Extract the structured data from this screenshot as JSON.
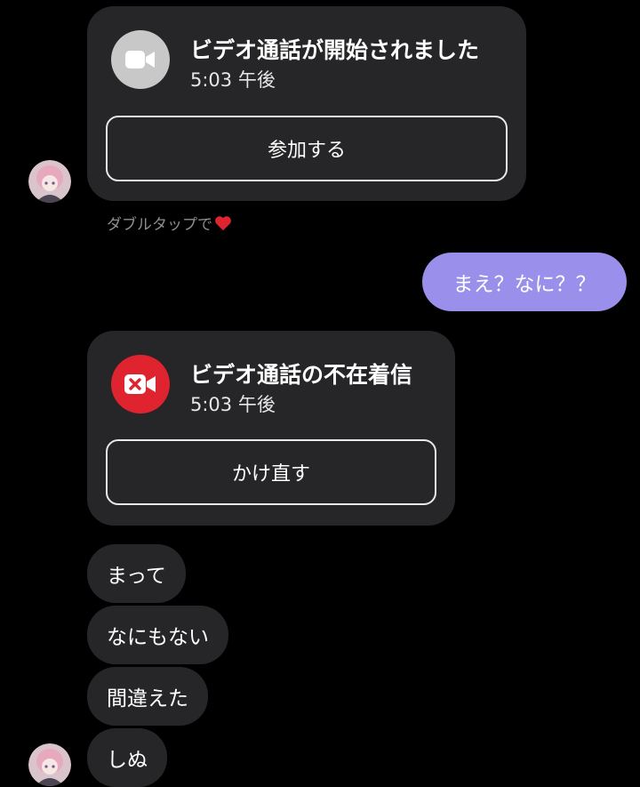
{
  "call_started": {
    "title": "ビデオ通話が開始されました",
    "time": "5:03 午後",
    "button_label": "参加する",
    "icon": "video-camera-icon",
    "icon_bg": "#c8c8c8"
  },
  "double_tap_hint": {
    "text": "ダブルタップで",
    "icon": "heart-icon",
    "icon_color": "#e0242f"
  },
  "sent_message": {
    "text": "まえ？なに？？",
    "bubble_color": "#9a8fea"
  },
  "missed_call": {
    "title": "ビデオ通話の不在着信",
    "time": "5:03 午後",
    "button_label": "かけ直す",
    "icon": "missed-video-call-icon",
    "icon_bg": "#e0242f"
  },
  "received_messages": [
    {
      "text": "まって"
    },
    {
      "text": "なにもない"
    },
    {
      "text": "間違えた"
    },
    {
      "text": "しぬ"
    }
  ],
  "colors": {
    "background": "#000000",
    "card_bg": "#262628",
    "hint_text": "#8e8e8e"
  }
}
